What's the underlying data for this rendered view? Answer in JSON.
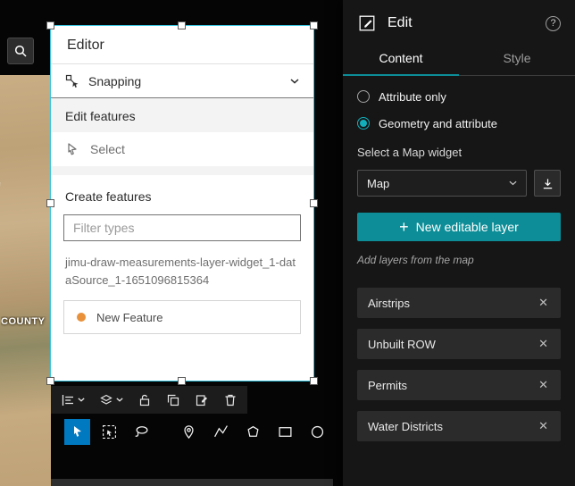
{
  "icons": {
    "close": "✕",
    "plus": "+",
    "question": "?"
  },
  "colors": {
    "accent_teal": "#0c8d97",
    "radio_teal": "#12b0bc",
    "selected_tool_blue": "#0079c1",
    "template_dot_orange": "#e8913a",
    "selection_outline": "#35c4e0"
  },
  "map": {
    "county_label": "COUNTY"
  },
  "editor_widget": {
    "title": "Editor",
    "snapping_label": "Snapping",
    "edit_features_heading": "Edit features",
    "select_label": "Select",
    "create_features_heading": "Create features",
    "filter_placeholder": "Filter types",
    "datasource_name": "jimu-draw-measurements-layer-widget_1-dataSource_1-1651096815364",
    "new_feature_label": "New Feature"
  },
  "settings_panel": {
    "title": "Edit",
    "tabs": [
      {
        "label": "Content",
        "active": true
      },
      {
        "label": "Style",
        "active": false
      }
    ],
    "options": [
      {
        "label": "Attribute only",
        "selected": false
      },
      {
        "label": "Geometry and attribute",
        "selected": true
      }
    ],
    "map_widget_label": "Select a Map widget",
    "map_widget_value": "Map",
    "new_layer_button_label": "New editable layer",
    "add_layers_label": "Add layers from the map",
    "layers": [
      {
        "name": "Airstrips"
      },
      {
        "name": "Unbuilt ROW"
      },
      {
        "name": "Permits"
      },
      {
        "name": "Water Districts"
      }
    ]
  }
}
